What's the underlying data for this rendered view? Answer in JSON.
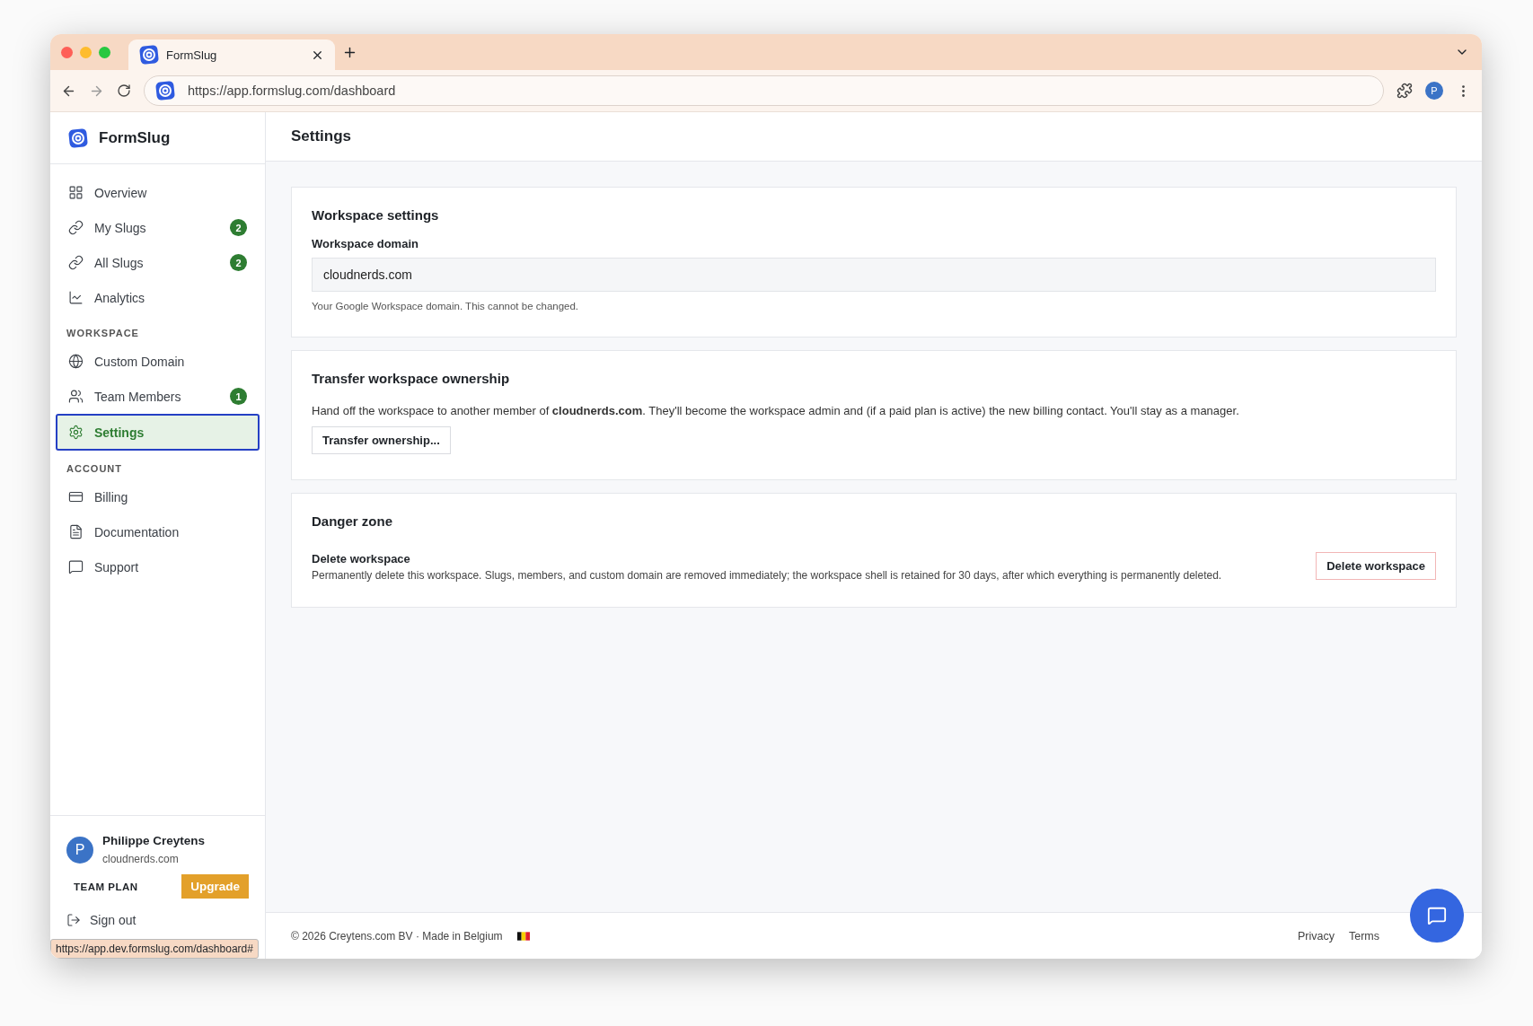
{
  "browser": {
    "tab_title": "FormSlug",
    "url": "https://app.formslug.com/dashboard",
    "profile_initial": "P"
  },
  "sidebar": {
    "brand": "FormSlug",
    "sections": [
      {
        "items": [
          {
            "label": "Overview",
            "selected": false
          },
          {
            "label": "My Slugs",
            "badge": "2",
            "selected": false
          },
          {
            "label": "All Slugs",
            "badge": "2",
            "selected": false
          },
          {
            "label": "Analytics",
            "selected": false
          }
        ]
      },
      {
        "heading": "WORKSPACE",
        "items": [
          {
            "label": "Custom Domain",
            "selected": false
          },
          {
            "label": "Team Members",
            "badge": "1",
            "selected": false
          },
          {
            "label": "Settings",
            "selected": true
          }
        ]
      },
      {
        "heading": "ACCOUNT",
        "items": [
          {
            "label": "Billing",
            "selected": false
          },
          {
            "label": "Documentation",
            "selected": false
          },
          {
            "label": "Support",
            "selected": false
          }
        ]
      }
    ],
    "user": {
      "initial": "P",
      "name": "Philippe Creytens",
      "domain": "cloudnerds.com",
      "plan": "TEAM PLAN",
      "upgrade": "Upgrade"
    },
    "sign_out": "Sign out"
  },
  "status_link": "https://app.dev.formslug.com/dashboard#",
  "main": {
    "title": "Settings",
    "workspace_settings": {
      "title": "Workspace settings",
      "field_label": "Workspace domain",
      "field_value": "cloudnerds.com",
      "help": "Your Google Workspace domain. This cannot be changed."
    },
    "transfer": {
      "title": "Transfer workspace ownership",
      "text": "Hand off the workspace to another member of **cloudnerds.com**. They'll become the workspace admin and (if a paid plan is active) the new billing contact. You'll stay as a manager.",
      "button": "Transfer ownership..."
    },
    "danger": {
      "title": "Danger zone",
      "item_title": "Delete workspace",
      "item_text": "Permanently delete this workspace. Slugs, members, and custom domain are removed immediately; the workspace shell is retained for 30 days, after which everything is permanently deleted.",
      "button": "Delete workspace"
    }
  },
  "footer": {
    "copyright": "© 2026 Creytens.com BV · Made in Belgium",
    "links": [
      "Privacy",
      "Terms"
    ]
  }
}
